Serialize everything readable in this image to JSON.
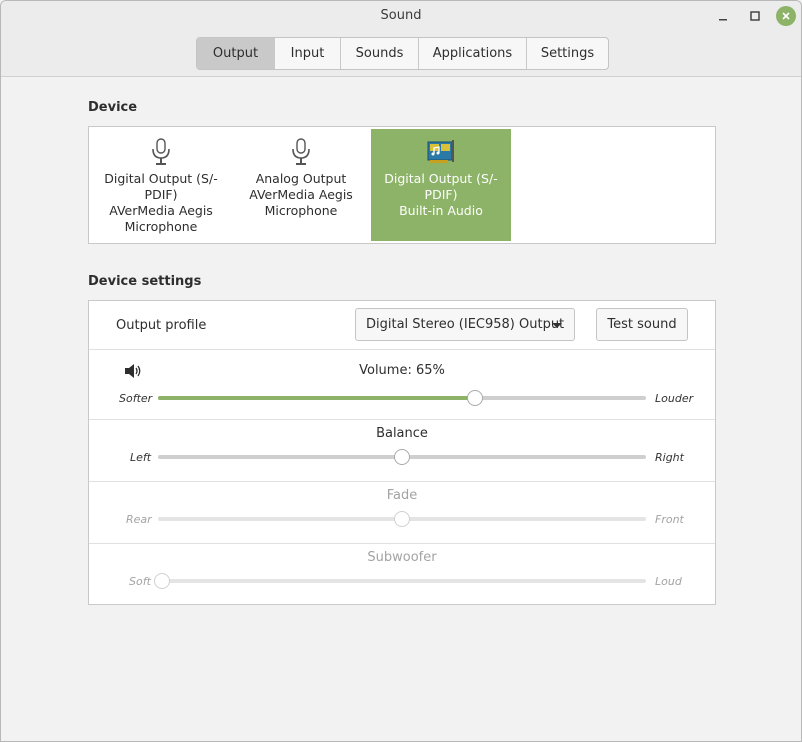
{
  "window": {
    "title": "Sound"
  },
  "tabs": [
    "Output",
    "Input",
    "Sounds",
    "Applications",
    "Settings"
  ],
  "active_tab": "Output",
  "device_section": {
    "heading": "Device",
    "devices": [
      {
        "label": "Digital Output (S/-\nPDIF)\nAVerMedia Aegis\nMicrophone",
        "icon": "microphone-icon",
        "selected": false
      },
      {
        "label": "Analog Output\nAVerMedia Aegis\nMicrophone",
        "icon": "microphone-icon",
        "selected": true
      },
      {
        "label": "Digital Output (S/-\nPDIF)\nBuilt-in Audio",
        "icon": "sound-card-icon",
        "selected": true
      }
    ]
  },
  "settings_section": {
    "heading": "Device settings",
    "output_profile": {
      "label": "Output profile",
      "value": "Digital Stereo (IEC958) Output"
    },
    "test_sound_label": "Test sound",
    "volume": {
      "title": "Volume: 65%",
      "left": "Softer",
      "right": "Louder",
      "value": 0.65,
      "icon": "speaker-icon"
    },
    "balance": {
      "title": "Balance",
      "left": "Left",
      "right": "Right",
      "value": 0.5
    },
    "fade": {
      "title": "Fade",
      "left": "Rear",
      "right": "Front",
      "value": 0.5,
      "enabled": false
    },
    "subwoofer": {
      "title": "Subwoofer",
      "left": "Soft",
      "right": "Loud",
      "value": 0.0,
      "enabled": false
    }
  },
  "colors": {
    "accent": "#8cb367"
  }
}
